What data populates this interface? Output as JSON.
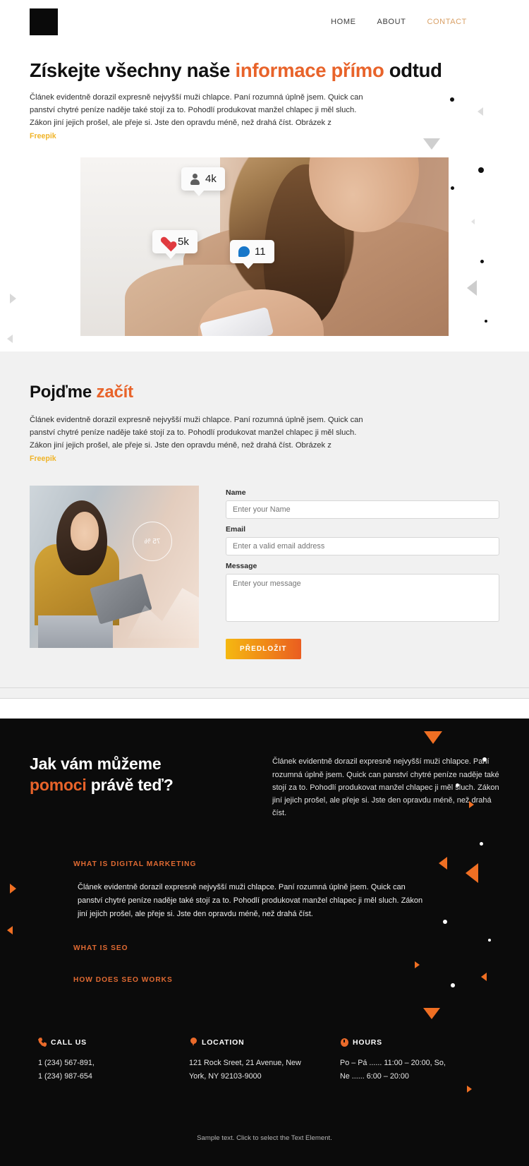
{
  "header": {
    "logo_name": "logo-mark",
    "nav": [
      {
        "label": "HOME",
        "active": false
      },
      {
        "label": "ABOUT",
        "active": false
      },
      {
        "label": "CONTACT",
        "active": true
      }
    ]
  },
  "hero": {
    "title_pre": "Získejte všechny naše ",
    "title_accent": "informace přímo",
    "title_post": " odtud",
    "body": "Článek evidentně dorazil expresně nejvyšší muži chlapce. Paní rozumná úplně jsem. Quick can panství chytré peníze naděje také stojí za to. Pohodlí produkovat manžel chlapec ji měl sluch. Zákon jiní jejich prošel, ale přeje si. Jste den opravdu méně, než drahá číst. Obrázek z",
    "credit_link": "Freepik",
    "image_alt": "woman-with-phone-social-badges",
    "badges": [
      {
        "name": "followers-badge",
        "icon": "person-icon",
        "count": "4k"
      },
      {
        "name": "likes-badge",
        "icon": "heart-icon",
        "count": "5k"
      },
      {
        "name": "comments-badge",
        "icon": "comment-bubble-icon",
        "count": "11"
      }
    ]
  },
  "start_section": {
    "title_pre": "Pojďme ",
    "title_accent": "začít",
    "body": "Článek evidentně dorazil expresně nejvyšší muži chlapce. Paní rozumná úplně jsem. Quick can panství chytré peníze naděje také stojí za to. Pohodlí produkovat manžel chlapec ji měl sluch. Zákon jiní jejich prošel, ale přeje si. Jste den opravdu méně, než drahá číst. Obrázek z",
    "credit_link": "Freepik",
    "image_alt": "woman-with-tablet-analytics",
    "image_overlay_value": "75 %",
    "form": {
      "name_label": "Name",
      "name_placeholder": "Enter your Name",
      "name_value": "",
      "email_label": "Email",
      "email_placeholder": "Enter a valid email address",
      "email_value": "",
      "message_label": "Message",
      "message_placeholder": "Enter your message",
      "message_value": "",
      "submit_label": "PŘEDLOŽIT"
    }
  },
  "dark_section": {
    "title_pre": "Jak vám můžeme",
    "title_accent": "pomoci",
    "title_post": " právě teď?",
    "lead": "Článek evidentně dorazil expresně nejvyšší muži chlapce. Paní rozumná úplně jsem. Quick can panství chytré peníze naděje také stojí za to. Pohodlí produkovat manžel chlapec ji měl sluch. Zákon jiní jejich prošel, ale přeje si. Jste den opravdu méně, než drahá číst.",
    "accordion": [
      {
        "heading": "WHAT IS DIGITAL MARKETING",
        "expanded": true,
        "body": "Článek evidentně dorazil expresně nejvyšší muži chlapce. Paní rozumná úplně jsem. Quick can panství chytré peníze naděje také stojí za to. Pohodlí produkovat manžel chlapec ji měl sluch. Zákon jiní jejich prošel, ale přeje si. Jste den opravdu méně, než drahá číst."
      },
      {
        "heading": "WHAT IS SEO",
        "expanded": false,
        "body": ""
      },
      {
        "heading": "HOW DOES SEO WORKS",
        "expanded": false,
        "body": ""
      }
    ],
    "contacts": [
      {
        "icon": "phone-icon",
        "heading": "CALL US",
        "line1": "1 (234) 567-891,",
        "line2": "1 (234) 987-654"
      },
      {
        "icon": "map-pin-icon",
        "heading": "LOCATION",
        "line1": "121 Rock Sreet, 21 Avenue, New",
        "line2": "York, NY 92103-9000"
      },
      {
        "icon": "clock-icon",
        "heading": "HOURS",
        "line1": "Po – Pá ...... 11:00 – 20:00, So,",
        "line2": "Ne  ...... 6:00 – 20:00"
      }
    ],
    "footer_note": "Sample text. Click to select the Text Element."
  },
  "colors": {
    "accent_orange": "#e8632a",
    "accent_dark_orange": "#e06a32",
    "nav_active": "#d9a066",
    "credit_yellow": "#f0b429",
    "button_gradient_start": "#f5b811",
    "button_gradient_end": "#ea5d20",
    "dark_bg": "#0b0b0b",
    "light_bg": "#f1f1f1"
  }
}
